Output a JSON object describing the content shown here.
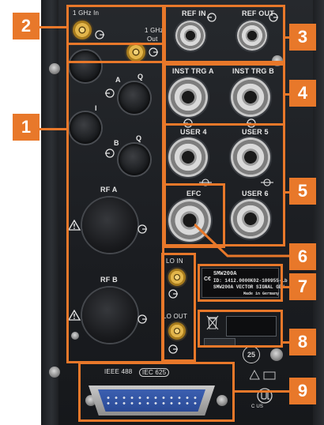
{
  "callouts": [
    "1",
    "2",
    "3",
    "4",
    "5",
    "6",
    "7",
    "8",
    "9"
  ],
  "labels": {
    "ghz_in": "1 GHz In",
    "ghz_out_1": "1 GHz",
    "ghz_out_2": "Out",
    "a": "A",
    "q1": "Q",
    "i": "I",
    "b": "B",
    "q2": "Q",
    "rf_a": "RF A",
    "rf_b": "RF B",
    "ref_in": "REF IN",
    "ref_out": "REF OUT",
    "inst_trg_a": "INST TRG A",
    "inst_trg_b": "INST TRG B",
    "user_4": "USER 4",
    "user_5": "USER 5",
    "efc": "EFC",
    "user_6": "USER 6",
    "lo_in": "LO IN",
    "lo_out": "LO OUT",
    "ieee": "IEEE 488",
    "iec": "IEC 625"
  },
  "type_plate": {
    "model": "SMW200A",
    "id": "ID: 1412.0000K02-100955-Lb",
    "name": "SMW200A VECTOR SIGNAL GEN",
    "origin": "Made in Germany"
  },
  "marks": {
    "ce": "C€",
    "year": "25",
    "us": "C    US"
  },
  "colors": {
    "accent": "#e8782a",
    "panel": "#1f2226"
  },
  "icons": [
    "connector-arrow-icon",
    "warning-icon",
    "weee-bin-icon",
    "ul-mark-icon",
    "earth-ground-icon"
  ]
}
